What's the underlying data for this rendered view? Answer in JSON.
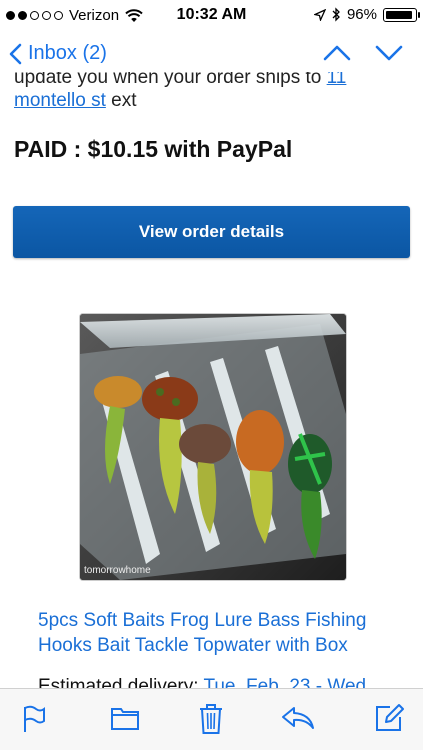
{
  "status_bar": {
    "carrier": "Verizon",
    "time": "10:32 AM",
    "battery": "96%"
  },
  "nav": {
    "back_label": "Inbox (2)"
  },
  "email": {
    "partial_text": "update you when your order ships to",
    "address_link_part1": "11",
    "address_link_part2": "montello st",
    "address_suffix": " ext",
    "paid_text": "PAID : $10.15 with PayPal",
    "cta_label": "View order details",
    "image_watermark": "tomorrowhome",
    "product_title": "5pcs Soft Baits Frog Lure Bass Fishing Hooks Bait Tackle Topwater with Box",
    "estimated_label": "Estimated delivery: ",
    "estimated_value": "Tue, Feb. 23 - Wed"
  },
  "colors": {
    "link": "#1a6fd6",
    "cta": "#0b56a3",
    "ios_blue": "#1a73e8"
  }
}
